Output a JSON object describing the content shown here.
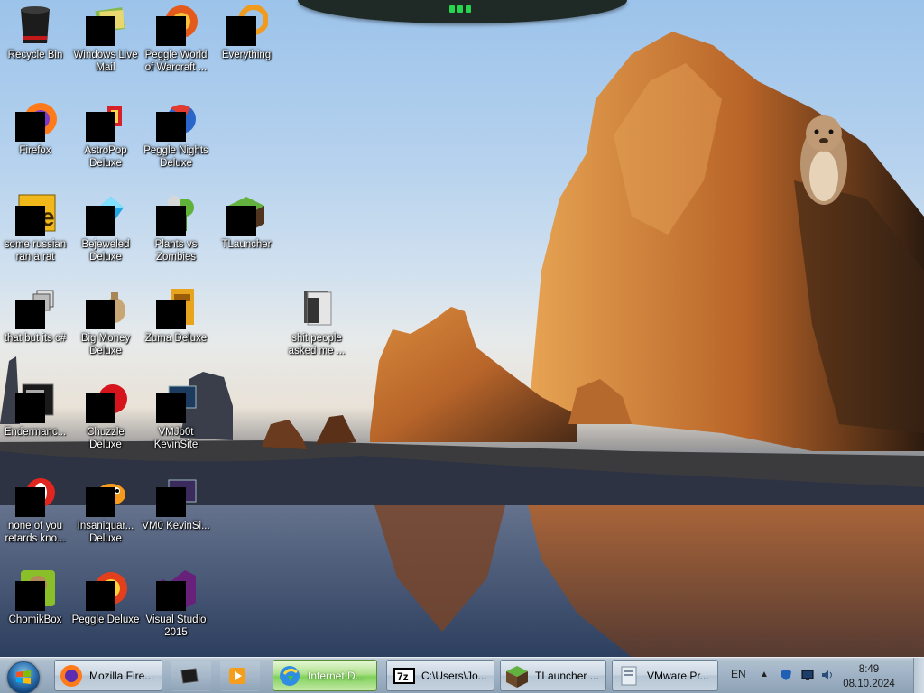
{
  "desktop": {
    "icons": [
      {
        "label": "Recycle Bin"
      },
      {
        "label": "Windows Live Mail"
      },
      {
        "label": "Peggle World of Warcraft ..."
      },
      {
        "label": "Everything"
      },
      {
        "label": "Firefox"
      },
      {
        "label": "AstroPop Deluxe"
      },
      {
        "label": "Peggle Nights Deluxe"
      },
      {
        "label": "some russian ran a rat"
      },
      {
        "label": "Bejeweled Deluxe"
      },
      {
        "label": "Plants vs Zombies"
      },
      {
        "label": "TLauncher"
      },
      {
        "label": "that but its c#"
      },
      {
        "label": "Big Money Deluxe"
      },
      {
        "label": "Zuma Deluxe"
      },
      {
        "label": "shit people asked me ..."
      },
      {
        "label": "Endermanc..."
      },
      {
        "label": "Chuzzle Deluxe"
      },
      {
        "label": "VMJb0t KevinSite"
      },
      {
        "label": "none of you retards kno..."
      },
      {
        "label": "Insaniquar... Deluxe"
      },
      {
        "label": "VM0 KevinSi..."
      },
      {
        "label": "ChomikBox"
      },
      {
        "label": "Peggle Deluxe"
      },
      {
        "label": "Visual Studio 2015"
      }
    ]
  },
  "taskbar": {
    "start_icon": "windows-orb-icon",
    "buttons": [
      {
        "label": "Mozilla Fire...",
        "icon": "firefox-icon"
      },
      {
        "label": "",
        "icon": "black-app-icon"
      },
      {
        "label": "",
        "icon": "media-player-icon"
      },
      {
        "label": "Internet D...",
        "icon": "internet-download-manager-icon"
      },
      {
        "label": "C:\\Users\\Jo...",
        "icon": "7zip-icon"
      },
      {
        "label": "TLauncher ...",
        "icon": "tlauncher-icon"
      },
      {
        "label": "VMware Pr...",
        "icon": "vmware-icon"
      }
    ],
    "tray": {
      "language": "EN",
      "time": "8:49",
      "date": "08.10.2024"
    }
  },
  "colors": {
    "taskbar_active": "#7fd25a",
    "notch_indicator": "#27d64e"
  }
}
